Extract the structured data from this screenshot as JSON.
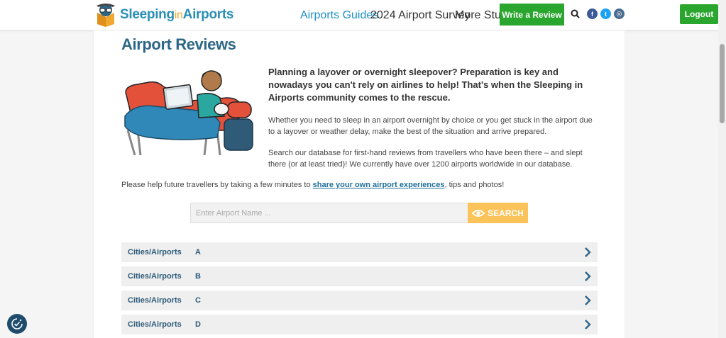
{
  "header": {
    "logo_main": "Sleeping",
    "logo_in": "in",
    "logo_end": "Airports",
    "nav": [
      "Airports Guides",
      "2024 Airport Survey",
      "More Stuff"
    ],
    "write_review": "Write a Review",
    "social": [
      "f",
      "t",
      "◎"
    ],
    "logout": "Logout",
    "accent_color": "#2aa52e"
  },
  "main": {
    "title": "Airport Reviews",
    "lead": "Planning a layover or overnight sleepover?  Preparation is key and nowadays you can't rely on airlines to help!  That's when the Sleeping in Airports community comes to the rescue.",
    "para1": "Whether you need to sleep in an airport overnight by choice or you get stuck in the airport due to a layover or weather delay, make the best of the situation and arrive prepared.",
    "para2": "Search our database for first-hand reviews from travellers who have been there – and slept there (or at least tried)!  We currently have over 1200 airports worldwide in our database.",
    "help_before": "Please help future travellers by taking a few minutes to ",
    "help_link": "share your own airport experiences",
    "help_after": ", tips and photos!",
    "search_placeholder": "Enter Airport Name ...",
    "search_button": "SEARCH"
  },
  "accordion": [
    {
      "label": "Cities/Airports",
      "letter": "A"
    },
    {
      "label": "Cities/Airports",
      "letter": "B"
    },
    {
      "label": "Cities/Airports",
      "letter": "C"
    },
    {
      "label": "Cities/Airports",
      "letter": "D"
    }
  ]
}
